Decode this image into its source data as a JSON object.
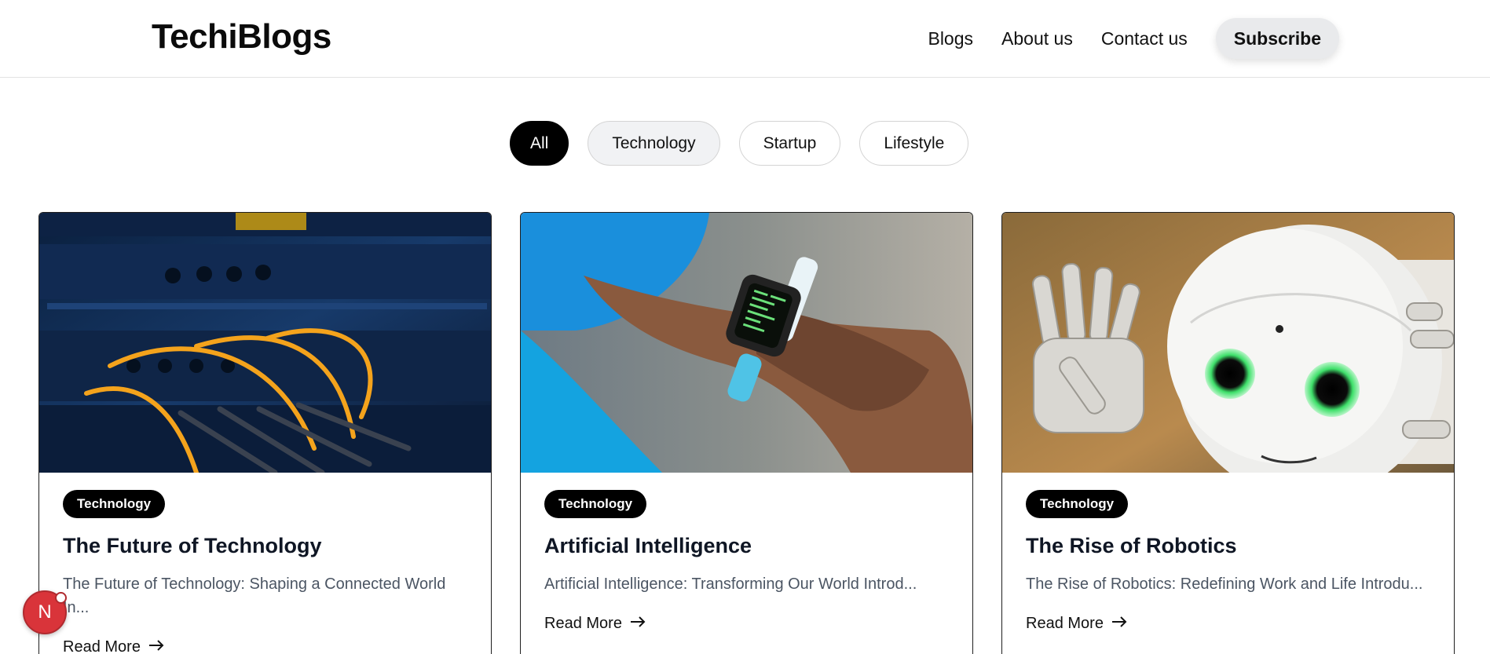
{
  "brand": {
    "name": "TechiBlogs"
  },
  "nav": {
    "links": [
      "Blogs",
      "About us",
      "Contact us"
    ],
    "subscribe_label": "Subscribe"
  },
  "filters": {
    "items": [
      "All",
      "Technology",
      "Startup",
      "Lifestyle"
    ],
    "selected": "All"
  },
  "cards": [
    {
      "category": "Technology",
      "title": "The Future of Technology",
      "excerpt": "The Future of Technology: Shaping a Connected World In...",
      "read_more": "Read More",
      "image": "network-cables-photo"
    },
    {
      "category": "Technology",
      "title": "Artificial Intelligence",
      "excerpt": "Artificial Intelligence: Transforming Our World Introd...",
      "read_more": "Read More",
      "image": "smartwatch-wrist-photo"
    },
    {
      "category": "Technology",
      "title": "The Rise of Robotics",
      "excerpt": "The Rise of Robotics: Redefining Work and Life Introdu...",
      "read_more": "Read More",
      "image": "humanoid-robot-photo"
    }
  ],
  "dev_badge": {
    "letter": "N"
  },
  "colors": {
    "accent": "#000000",
    "chip_hover": "#f1f2f4",
    "subscribe_bg": "#e9eaec",
    "fab": "#d9343a"
  }
}
